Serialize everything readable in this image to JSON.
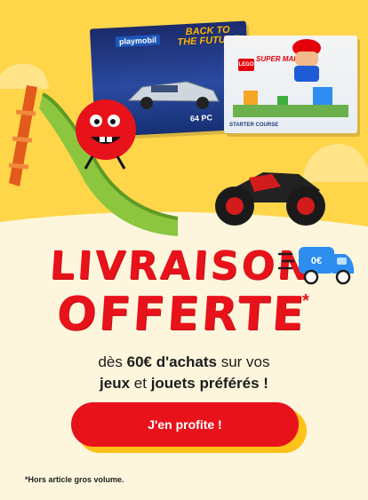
{
  "colors": {
    "accent_red": "#e8121b",
    "hero_yellow": "#ffd64a",
    "cream": "#fdf6dd",
    "truck_blue": "#2d8ef0",
    "button_shadow": "#ffc21a"
  },
  "images": {
    "playmobil_box": {
      "brand": "playmobil",
      "title_art": "BACK TO THE FUTURE",
      "count_label": "64 PC"
    },
    "lego_box": {
      "brand": "LEGO",
      "title": "SUPER MARIO",
      "subtitle": "STARTER COURSE"
    },
    "slide": {
      "icon": "slide-icon"
    },
    "quad": {
      "icon": "ride-on-quad-icon"
    },
    "mascot": {
      "icon": "red-mascot-icon"
    }
  },
  "headline": {
    "line1": "LIVRAISON",
    "line2": "OFFERTE",
    "asterisk": "*"
  },
  "truck_badge": {
    "icon": "delivery-truck-icon",
    "price": "0€"
  },
  "offer": {
    "line1_prefix": "dès ",
    "line1_amount": "60€",
    "line1_bold": " d'achats",
    "line1_suffix": " sur vos",
    "line2_bold": "jeux",
    "line2_mid": " et ",
    "line2_bold2": "jouets préférés !"
  },
  "cta": {
    "label": "J'en profite !"
  },
  "footnote": {
    "text": "*Hors article gros volume."
  }
}
